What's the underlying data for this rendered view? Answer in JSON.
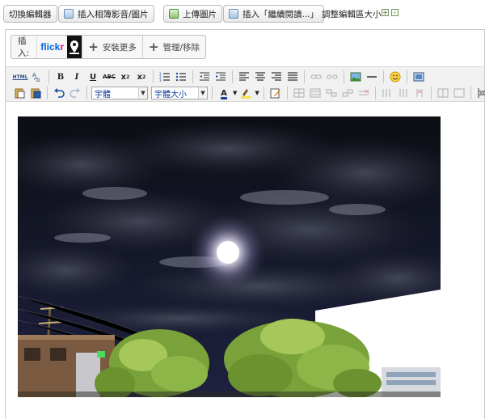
{
  "topbar": {
    "toggle_editor": "切換編輯器",
    "insert_album": "插入相簿影音/圖片",
    "upload_image": "上傳圖片",
    "insert_continue": "插入「繼續閱讀...」",
    "resize_label": "調整編輯區大小",
    "expand": "+",
    "collapse": "-"
  },
  "insert_bar": {
    "label": "插入:",
    "flickr_a": "flick",
    "flickr_b": "r",
    "install_more": "安裝更多",
    "manage_remove": "管理/移除"
  },
  "toolbar": {
    "html_label": "HTML",
    "font_family": "宇體",
    "font_size": "宇體大小"
  },
  "icons": [
    "plus-icon",
    "minus-icon",
    "flickr-icon",
    "map-pin-icon",
    "bold-icon",
    "italic-icon",
    "underline-icon",
    "strikethrough-icon",
    "subscript-icon",
    "superscript-icon",
    "smiley-icon",
    "undo-icon",
    "redo-icon",
    "image-icon"
  ],
  "colors": {
    "flickr_blue": "#0063dc",
    "flickr_pink": "#ff0084",
    "toolbar_bg": "#f1f1f1",
    "select_text": "#0b3a9b"
  }
}
